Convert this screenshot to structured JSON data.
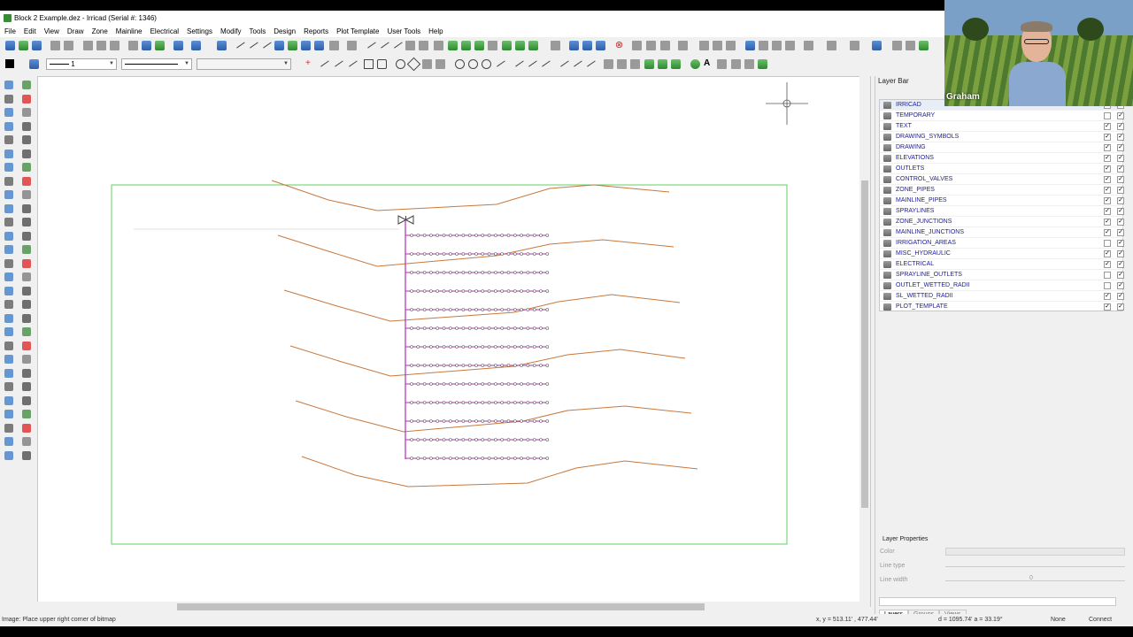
{
  "window": {
    "title": "Block 2 Example.dez - Irricad (Serial #: 1346)"
  },
  "menu": [
    "File",
    "Edit",
    "View",
    "Draw",
    "Zone",
    "Mainline",
    "Electrical",
    "Settings",
    "Modify",
    "Tools",
    "Design",
    "Reports",
    "Plot Template",
    "User Tools",
    "Help"
  ],
  "toolbar": {
    "linewidth_value": "1"
  },
  "layer_bar": {
    "title": "Layer Bar",
    "layers": [
      {
        "name": "IRRICAD",
        "c1": false,
        "c2": true
      },
      {
        "name": "TEMPORARY",
        "c1": false,
        "c2": true
      },
      {
        "name": "TEXT",
        "c1": true,
        "c2": true
      },
      {
        "name": "DRAWING_SYMBOLS",
        "c1": true,
        "c2": true
      },
      {
        "name": "DRAWING",
        "c1": true,
        "c2": true
      },
      {
        "name": "ELEVATIONS",
        "c1": true,
        "c2": true
      },
      {
        "name": "OUTLETS",
        "c1": true,
        "c2": true
      },
      {
        "name": "CONTROL_VALVES",
        "c1": true,
        "c2": true
      },
      {
        "name": "ZONE_PIPES",
        "c1": true,
        "c2": true
      },
      {
        "name": "MAINLINE_PIPES",
        "c1": true,
        "c2": true
      },
      {
        "name": "SPRAYLINES",
        "c1": true,
        "c2": true
      },
      {
        "name": "ZONE_JUNCTIONS",
        "c1": true,
        "c2": true
      },
      {
        "name": "MAINLINE_JUNCTIONS",
        "c1": true,
        "c2": true
      },
      {
        "name": "IRRIGATION_AREAS",
        "c1": false,
        "c2": true
      },
      {
        "name": "MISC_HYDRAULIC",
        "c1": true,
        "c2": true
      },
      {
        "name": "ELECTRICAL",
        "c1": true,
        "c2": true
      },
      {
        "name": "SPRAYLINE_OUTLETS",
        "c1": false,
        "c2": true
      },
      {
        "name": "OUTLET_WETTED_RADII",
        "c1": false,
        "c2": true
      },
      {
        "name": "SL_WETTED_RADII",
        "c1": true,
        "c2": true
      },
      {
        "name": "PLOT_TEMPLATE",
        "c1": true,
        "c2": true
      }
    ],
    "properties": {
      "header": "Layer Properties",
      "color_label": "Color",
      "linetype_label": "Line type",
      "linewidth_label": "Line width",
      "linewidth_value": "0"
    },
    "tabs": [
      "Layers",
      "Groups",
      "Views"
    ]
  },
  "status": {
    "prompt": "Image: Place upper right corner of bitmap",
    "coords": "x, y = 513.11' , 477.44'",
    "distance": "d = 1095.74'  a = 33.19°",
    "snap": "None",
    "connect": "Connect"
  },
  "video": {
    "participant": "Graham"
  },
  "colors": {
    "contour": "#c8783c",
    "lateral": "#b030b0",
    "boundary": "#60d060",
    "layer_name": "#1a1aa0"
  }
}
